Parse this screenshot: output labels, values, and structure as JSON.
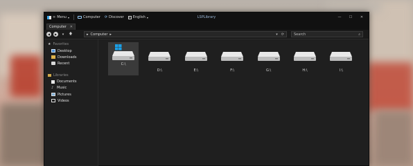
{
  "titlebar": {
    "menu_label": "Menu",
    "computer_label": "Computer",
    "discover_label": "Discover",
    "language_label": "English",
    "window_title": "LSPLibrary",
    "min_glyph": "—",
    "max_glyph": "☐",
    "close_glyph": "✕"
  },
  "tabs": [
    {
      "label": "Computer",
      "close": "✕"
    }
  ],
  "navbar": {
    "address_root_glyph": "▸",
    "address_path": "Computer",
    "address_chevron": "▸",
    "address_dropdown": "▾",
    "address_refresh": "⟳",
    "search_placeholder": "Search",
    "search_icon": "⌕"
  },
  "sidebar": {
    "favorites_header": "Favorites",
    "favorites": [
      {
        "label": "Desktop",
        "icon": "desktop-icon"
      },
      {
        "label": "Downloads",
        "icon": "downloads-icon"
      },
      {
        "label": "Recent",
        "icon": "recent-icon"
      }
    ],
    "libraries_header": "Libraries",
    "libraries": [
      {
        "label": "Documents",
        "icon": "documents-icon"
      },
      {
        "label": "Music",
        "icon": "music-icon"
      },
      {
        "label": "Pictures",
        "icon": "pictures-icon"
      },
      {
        "label": "Videos",
        "icon": "videos-icon"
      }
    ]
  },
  "drives": [
    {
      "label": "C:\\",
      "selected": true,
      "windows_logo": true
    },
    {
      "label": "D:\\",
      "selected": false
    },
    {
      "label": "E:\\",
      "selected": false
    },
    {
      "label": "F:\\",
      "selected": false
    },
    {
      "label": "G:\\",
      "selected": false
    },
    {
      "label": "H:\\",
      "selected": false
    },
    {
      "label": "I:\\",
      "selected": false
    }
  ],
  "colors": {
    "window_bg": "#1f1f1f",
    "titlebar_bg": "#111111",
    "accent_blue": "#1aa0e8",
    "title_text": "#9bb8d8"
  }
}
